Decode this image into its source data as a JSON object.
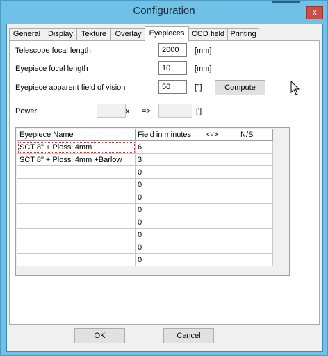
{
  "window": {
    "title": "Configuration",
    "close_glyph": "x"
  },
  "tabs": [
    {
      "label": "General"
    },
    {
      "label": "Display"
    },
    {
      "label": "Texture"
    },
    {
      "label": "Overlay"
    },
    {
      "label": "Eyepieces",
      "active": true
    },
    {
      "label": "CCD field"
    },
    {
      "label": "Printing"
    }
  ],
  "form": {
    "telescope_focal_length": {
      "label": "Telescope focal length",
      "value": "2000",
      "unit": "[mm]"
    },
    "eyepiece_focal_length": {
      "label": "Eyepiece focal length",
      "value": "10",
      "unit": "[mm]"
    },
    "eyepiece_fov": {
      "label": "Eyepiece apparent field of vision",
      "value": "50",
      "unit": "[°]"
    },
    "compute_label": "Compute",
    "power": {
      "label": "Power",
      "value": "",
      "x_glyph": "x",
      "arrow": "=>",
      "result": "",
      "result_unit": "[']"
    }
  },
  "table": {
    "headers": [
      "Eyepiece Name",
      "Field in minutes",
      "<->",
      "N/S"
    ],
    "rows": [
      [
        "SCT 8\" + Plossl 4mm",
        "6",
        "",
        ""
      ],
      [
        "SCT 8\" + Plossl 4mm +Barlow",
        "3",
        "",
        ""
      ],
      [
        "",
        "0",
        "",
        ""
      ],
      [
        "",
        "0",
        "",
        ""
      ],
      [
        "",
        "0",
        "",
        ""
      ],
      [
        "",
        "0",
        "",
        ""
      ],
      [
        "",
        "0",
        "",
        ""
      ],
      [
        "",
        "0",
        "",
        ""
      ],
      [
        "",
        "0",
        "",
        ""
      ],
      [
        "",
        "0",
        "",
        ""
      ]
    ]
  },
  "buttons": {
    "ok": "OK",
    "cancel": "Cancel"
  },
  "colors": {
    "frame": "#6fc1e5",
    "close": "#c7504a"
  },
  "icons": {
    "cursor": "mouse-pointer-icon"
  }
}
